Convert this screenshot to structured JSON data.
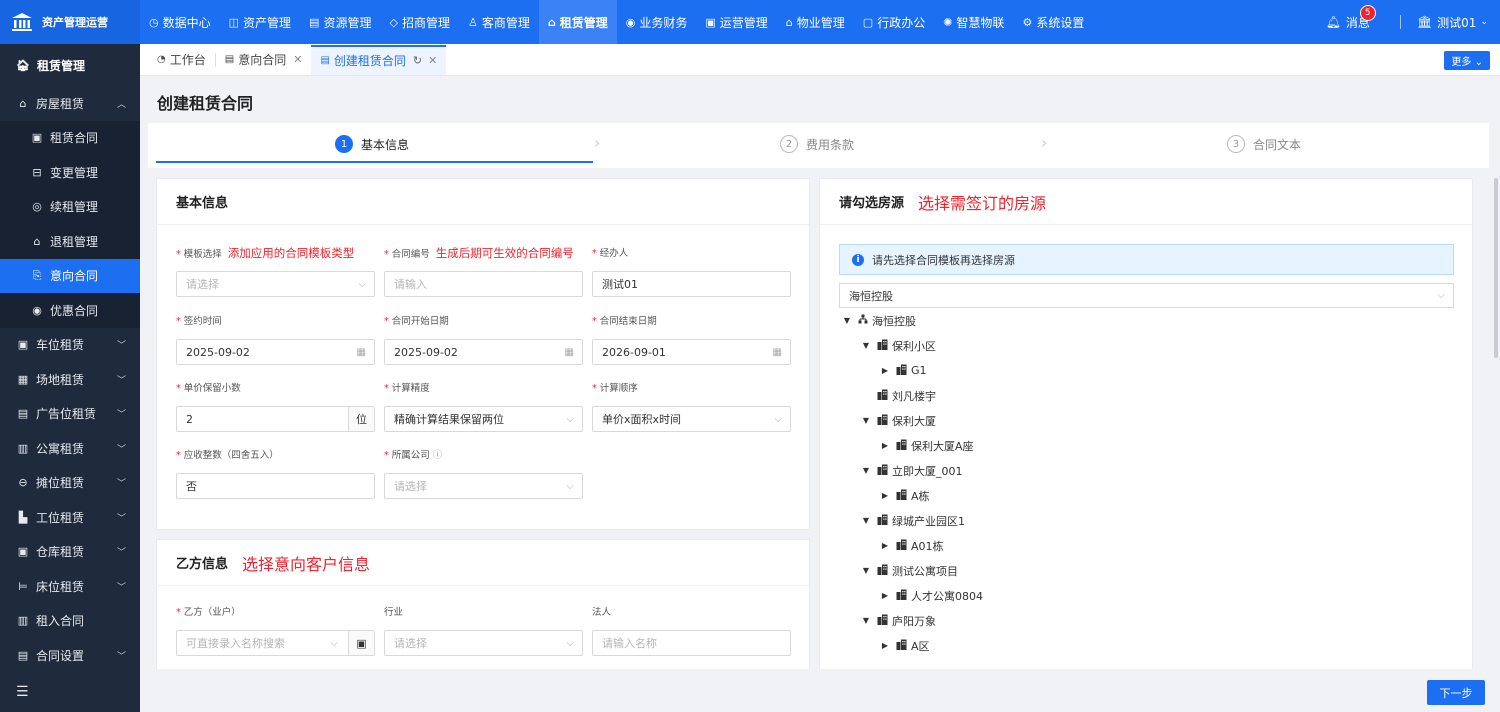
{
  "app": {
    "name": "资产管理运营"
  },
  "topnav": [
    {
      "icon": "◷",
      "label": "数据中心"
    },
    {
      "icon": "◫",
      "label": "资产管理"
    },
    {
      "icon": "▤",
      "label": "资源管理"
    },
    {
      "icon": "◇",
      "label": "招商管理"
    },
    {
      "icon": "♙",
      "label": "客商管理"
    },
    {
      "icon": "⌂",
      "label": "租赁管理"
    },
    {
      "icon": "◉",
      "label": "业务财务"
    },
    {
      "icon": "▣",
      "label": "运营管理"
    },
    {
      "icon": "⌂",
      "label": "物业管理"
    },
    {
      "icon": "▢",
      "label": "行政办公"
    },
    {
      "icon": "✺",
      "label": "智慧物联"
    },
    {
      "icon": "⚙",
      "label": "系统设置"
    }
  ],
  "header": {
    "message_label": "消息",
    "message_count": "5",
    "user": "测试01"
  },
  "sidebar": {
    "title": "租赁管理",
    "house_group": "房屋租赁",
    "sub_items": [
      "租赁合同",
      "变更管理",
      "续租管理",
      "退租管理",
      "意向合同",
      "优惠合同"
    ],
    "groups": [
      "车位租赁",
      "场地租赁",
      "广告位租赁",
      "公寓租赁",
      "摊位租赁",
      "工位租赁",
      "仓库租赁",
      "床位租赁",
      "租入合同",
      "合同设置"
    ]
  },
  "tabs": {
    "workbench": "工作台",
    "intent": "意向合同",
    "create": "创建租赁合同",
    "more": "更多"
  },
  "page": {
    "title": "创建租赁合同"
  },
  "steps": [
    {
      "num": "1",
      "label": "基本信息"
    },
    {
      "num": "2",
      "label": "费用条款"
    },
    {
      "num": "3",
      "label": "合同文本"
    }
  ],
  "basic": {
    "title": "基本信息",
    "template": {
      "label": "模板选择",
      "note": "添加应用的合同模板类型",
      "placeholder": "请选择"
    },
    "contract_no": {
      "label": "合同编号",
      "note": "生成后期可生效的合同编号",
      "placeholder": "请输入"
    },
    "handler": {
      "label": "经办人",
      "value": "测试01"
    },
    "sign_date": {
      "label": "签约时间",
      "value": "2025-09-02"
    },
    "start_date": {
      "label": "合同开始日期",
      "value": "2025-09-02"
    },
    "end_date": {
      "label": "合同结束日期",
      "value": "2026-09-01"
    },
    "decimal": {
      "label": "单价保留小数",
      "value": "2",
      "unit": "位"
    },
    "precision": {
      "label": "计算精度",
      "value": "精确计算结果保留两位"
    },
    "order": {
      "label": "计算顺序",
      "value": "单价x面积x时间"
    },
    "rounding": {
      "label": "应收整数（四舍五入）",
      "value": "否"
    },
    "company": {
      "label": "所属公司",
      "placeholder": "请选择"
    }
  },
  "party_b": {
    "title": "乙方信息",
    "note": "选择意向客户信息",
    "tenant": {
      "label": "乙方（业户）",
      "placeholder": "可直接录入名称搜索"
    },
    "industry": {
      "label": "行业",
      "placeholder": "请选择"
    },
    "legal": {
      "label": "法人",
      "placeholder": "请输入名称"
    }
  },
  "house": {
    "title": "请勾选房源",
    "note": "选择需签订的房源",
    "notice": "请先选择合同模板再选择房源",
    "selected": "海恒控股",
    "tree": [
      {
        "label": "海恒控股",
        "level": 0,
        "toggle": "▼",
        "icon": "org"
      },
      {
        "label": "保利小区",
        "level": 1,
        "toggle": "▼",
        "icon": "bld"
      },
      {
        "label": "G1",
        "level": 2,
        "toggle": "▶",
        "icon": "bld"
      },
      {
        "label": "刘凡楼宇",
        "level": 1,
        "toggle": "",
        "icon": "bld"
      },
      {
        "label": "保利大厦",
        "level": 1,
        "toggle": "▼",
        "icon": "bld"
      },
      {
        "label": "保利大厦A座",
        "level": 2,
        "toggle": "▶",
        "icon": "bld"
      },
      {
        "label": "立即大厦_001",
        "level": 1,
        "toggle": "▼",
        "icon": "bld"
      },
      {
        "label": "A栋",
        "level": 2,
        "toggle": "▶",
        "icon": "bld"
      },
      {
        "label": "绿城产业园区1",
        "level": 1,
        "toggle": "▼",
        "icon": "bld"
      },
      {
        "label": "A01栋",
        "level": 2,
        "toggle": "▶",
        "icon": "bld"
      },
      {
        "label": "测试公寓项目",
        "level": 1,
        "toggle": "▼",
        "icon": "bld"
      },
      {
        "label": "人才公寓0804",
        "level": 2,
        "toggle": "▶",
        "icon": "bld"
      },
      {
        "label": "庐阳万象",
        "level": 1,
        "toggle": "▼",
        "icon": "bld"
      },
      {
        "label": "A区",
        "level": 2,
        "toggle": "▶",
        "icon": "bld"
      }
    ]
  },
  "actions": {
    "next": "下一步"
  },
  "colors": {
    "primary": "#1d6ff2",
    "sidebar": "#1f2a3c",
    "annotation": "#f5222d"
  }
}
